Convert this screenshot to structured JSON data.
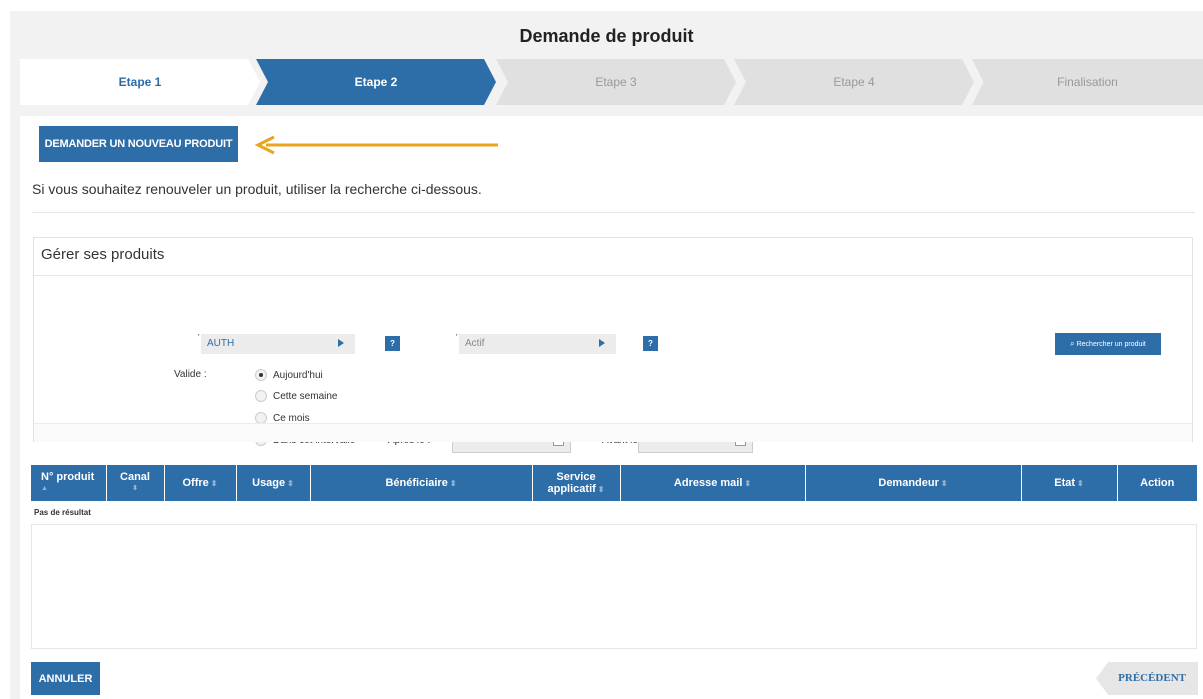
{
  "page": {
    "title": "Demande de produit"
  },
  "stepper": {
    "steps": [
      {
        "label": "Etape 1",
        "state": "done"
      },
      {
        "label": "Etape 2",
        "state": "active"
      },
      {
        "label": "Etape 3",
        "state": "pending"
      },
      {
        "label": "Etape 4",
        "state": "pending"
      },
      {
        "label": "Finalisation",
        "state": "pending"
      }
    ]
  },
  "actions": {
    "new_product": "DEMANDER UN NOUVEAU PRODUIT",
    "cancel": "ANNULER",
    "previous": "PRÉCÉDENT"
  },
  "intro": "Si vous souhaitez renouveler un produit, utiliser la recherche ci-dessous.",
  "search": {
    "title": "Gérer ses produits",
    "select_product": "AUTH",
    "select_status": "Actif",
    "help": "?",
    "search_button": "Rechercher un produit",
    "valide_label": "Valide :",
    "options": [
      "Aujourd'hui",
      "Cette semaine",
      "Ce mois",
      "Dans cet intervalle"
    ],
    "selected_option": "Aujourd'hui",
    "after_label": "Après le :",
    "before_label": "Avant le :",
    "after_value": "",
    "before_value": ""
  },
  "table": {
    "columns": [
      "N° produit",
      "Canal",
      "Offre",
      "Usage",
      "Bénéficiaire",
      "Service applicatif",
      "Adresse mail",
      "Demandeur",
      "Etat",
      "Action"
    ],
    "empty_message": "Pas de résultat"
  },
  "colors": {
    "primary": "#2e6ea8",
    "arrow": "#e8a520",
    "inactive_step": "#e0e0e0"
  }
}
